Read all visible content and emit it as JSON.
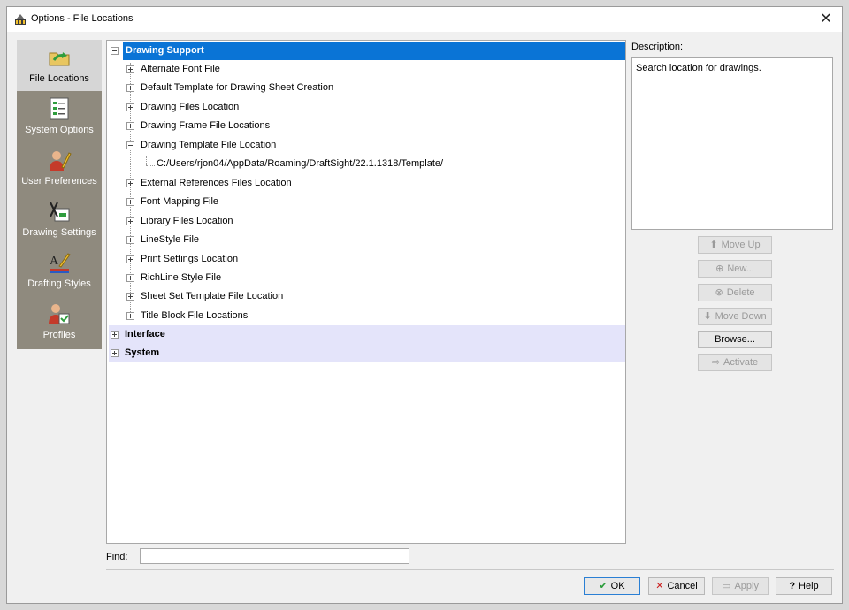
{
  "window": {
    "title": "Options - File Locations"
  },
  "sidebar": {
    "items": [
      {
        "label": "File Locations",
        "icon": "folder-arrow-icon",
        "active": true
      },
      {
        "label": "System Options",
        "icon": "checklist-icon"
      },
      {
        "label": "User Preferences",
        "icon": "user-pencil-icon"
      },
      {
        "label": "Drawing Settings",
        "icon": "drawing-tools-icon"
      },
      {
        "label": "Drafting Styles",
        "icon": "drafting-style-icon"
      },
      {
        "label": "Profiles",
        "icon": "profile-user-icon"
      }
    ]
  },
  "tree": {
    "root": "Drawing Support",
    "children": [
      "Alternate Font File",
      "Default Template for Drawing Sheet Creation",
      "Drawing Files Location",
      "Drawing Frame File Locations",
      "Drawing Template File Location",
      "External References Files Location",
      "Font Mapping File",
      "Library Files Location",
      "LineStyle File",
      "Print Settings Location",
      "RichLine Style File",
      "Sheet Set Template File Location",
      "Title Block File Locations"
    ],
    "template_path": "C:/Users/rjon04/AppData/Roaming/DraftSight/22.1.1318/Template/",
    "groups": [
      "Interface",
      "System"
    ]
  },
  "description": {
    "label": "Description:",
    "text": "Search location for drawings."
  },
  "actions": {
    "move_up": "Move  Up",
    "new": "New...",
    "delete": "Delete",
    "move_down": "Move Down",
    "browse": "Browse...",
    "activate": "Activate"
  },
  "find": {
    "label": "Find:",
    "value": ""
  },
  "footer": {
    "ok": "OK",
    "cancel": "Cancel",
    "apply": "Apply",
    "help": "Help"
  },
  "colors": {
    "selection": "#0a74d6",
    "sidebar": "#8f8a7e",
    "group_row": "#e4e4fa"
  }
}
